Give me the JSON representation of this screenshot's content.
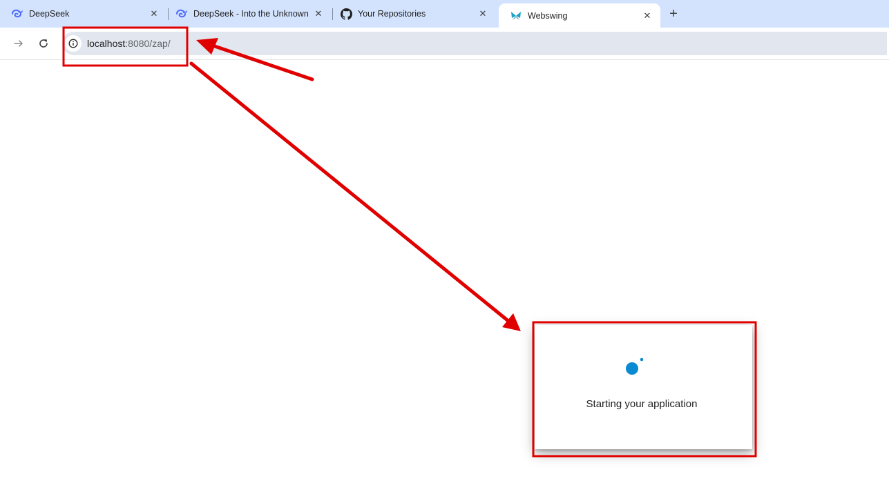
{
  "tabs": [
    {
      "title": "DeepSeek",
      "icon": "deepseek-whale-icon",
      "active": false
    },
    {
      "title": "DeepSeek - Into the Unknown",
      "icon": "deepseek-whale-icon",
      "active": false
    },
    {
      "title": "Your Repositories",
      "icon": "github-icon",
      "active": false
    },
    {
      "title": "Webswing",
      "icon": "webswing-butterfly-icon",
      "active": true
    }
  ],
  "toolbar": {
    "url_host": "localhost",
    "url_path": ":8080/zap/"
  },
  "dialog": {
    "message": "Starting your application"
  },
  "colors": {
    "tabstrip_bg": "#d3e3fd",
    "omnibox_bg": "#e2e7ef",
    "spinner": "#0a8bd1",
    "annotation_red": "#e00000",
    "deepseek_blue": "#4d6bfe",
    "webswing_teal": "#1aa0c8"
  }
}
